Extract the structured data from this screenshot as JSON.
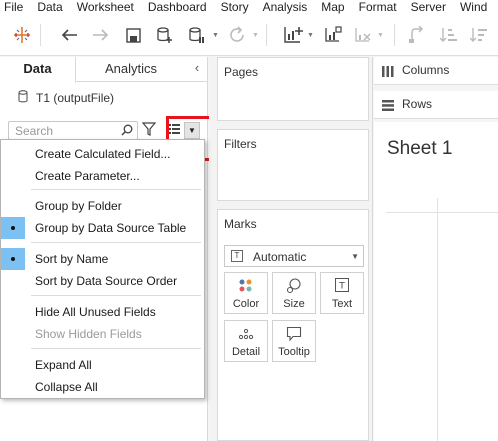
{
  "menubar": {
    "items": [
      "File",
      "Data",
      "Worksheet",
      "Dashboard",
      "Story",
      "Analysis",
      "Map",
      "Format",
      "Server",
      "Wind"
    ]
  },
  "toolbar": {
    "icons": [
      "tableau-logo-icon",
      "undo-icon",
      "redo-icon",
      "save-icon",
      "new-data-source-icon",
      "pause-updates-icon",
      "refresh-icon",
      "new-worksheet-icon",
      "duplicate-icon",
      "clear-sheet-icon",
      "swap-icon",
      "sort-ascending-icon",
      "sort-descending-icon"
    ]
  },
  "left_panel": {
    "tabs": {
      "data": "Data",
      "analytics": "Analytics"
    },
    "collapse": "‹",
    "datasource": "T1 (outputFile)",
    "search_placeholder": "Search"
  },
  "menu": {
    "items": [
      "Create Calculated Field...",
      "Create Parameter...",
      "Group by Folder",
      "Group by Data Source Table",
      "Sort by Name",
      "Sort by Data Source Order",
      "Hide All Unused Fields",
      "Show Hidden Fields",
      "Expand All",
      "Collapse All"
    ],
    "checked": [
      "Group by Data Source Table",
      "Sort by Name"
    ],
    "disabled": [
      "Show Hidden Fields"
    ]
  },
  "cards": {
    "pages": "Pages",
    "filters": "Filters",
    "marks": "Marks"
  },
  "marks": {
    "type": "Automatic",
    "buttons": {
      "color": "Color",
      "size": "Size",
      "text": "Text",
      "detail": "Detail",
      "tooltip": "Tooltip"
    }
  },
  "shelves": {
    "columns": "Columns",
    "rows": "Rows"
  },
  "sheet": {
    "title": "Sheet 1"
  },
  "colors": {
    "highlight": "#e8131b",
    "check": "#7cc1f2"
  }
}
